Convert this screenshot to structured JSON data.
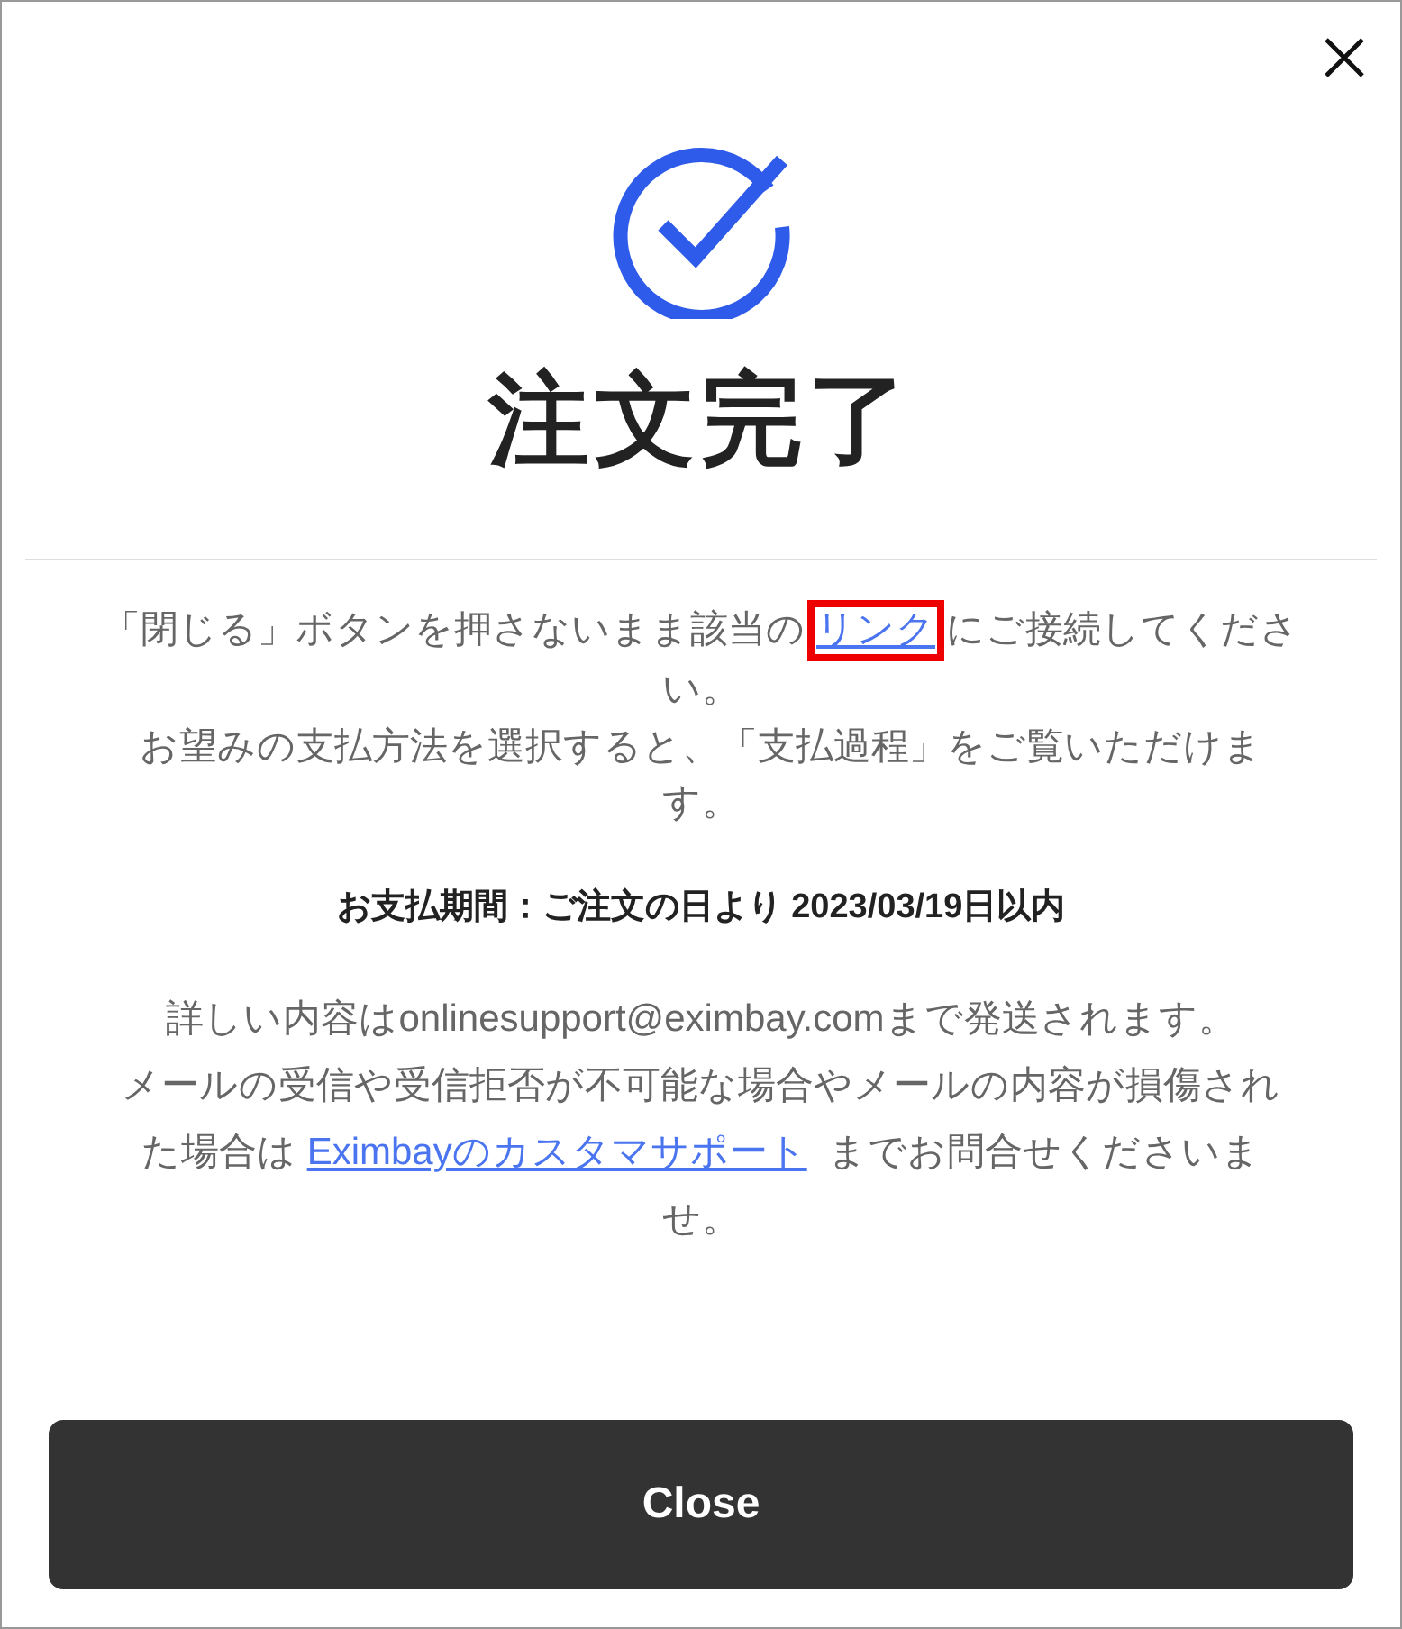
{
  "title": "注文完了",
  "notice": [
    {
      "parts": [
        {
          "kind": "text",
          "text": "「閉じる」ボタンを押さないまま該当の"
        },
        {
          "kind": "link",
          "text": "リンク",
          "highlighted": true
        },
        {
          "kind": "text",
          "text": "にご接続してください。"
        }
      ]
    },
    {
      "parts": [
        {
          "kind": "text",
          "text": "お望みの支払方法を選択すると、「支払過程」をご覧いただけます。"
        }
      ]
    }
  ],
  "payment_period": "お支払期間：ご注文の日より 2023/03/19日以内",
  "support": [
    {
      "parts": [
        {
          "kind": "text",
          "text": "詳しい内容はonlinesupport@eximbay.comまで発送されます。"
        }
      ]
    },
    {
      "parts": [
        {
          "kind": "text",
          "text": "メールの受信や受信拒否が不可能な場合やメールの内容が損傷された場合は"
        },
        {
          "kind": "link",
          "text": "Eximbayのカスタマサポート",
          "highlighted": false
        },
        {
          "kind": "text",
          "text": " までお問合せくださいませ。"
        }
      ]
    }
  ],
  "button": "Close"
}
